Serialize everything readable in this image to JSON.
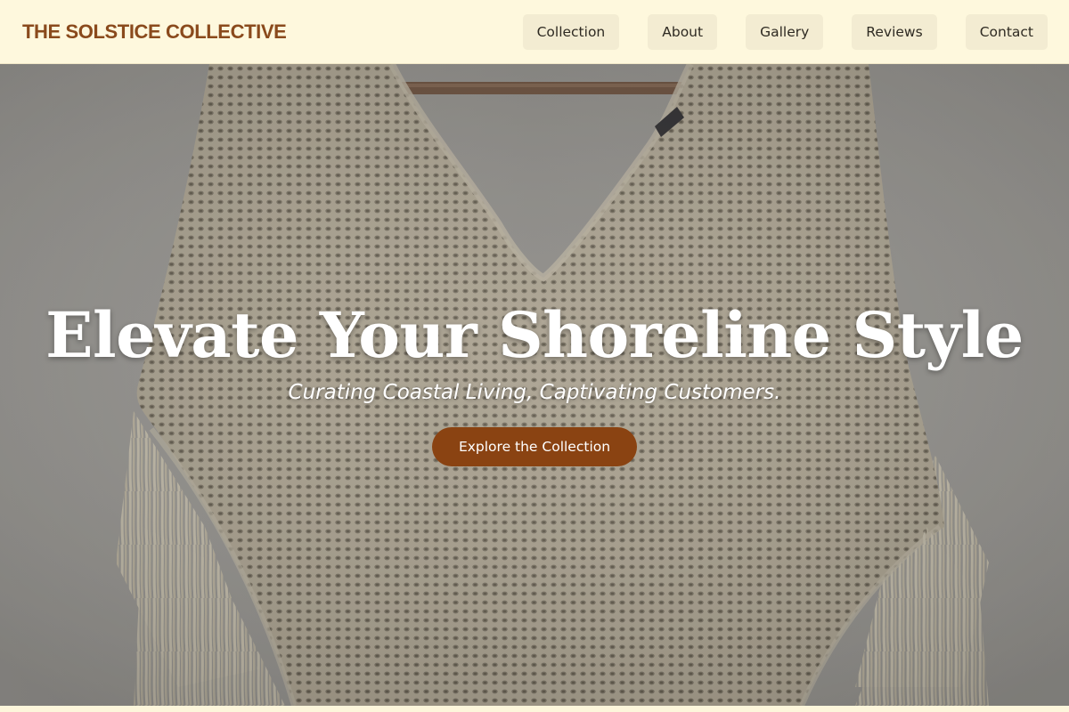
{
  "nav": {
    "brand": "THE SOLSTICE COLLECTIVE",
    "links": [
      {
        "label": "Collection"
      },
      {
        "label": "About"
      },
      {
        "label": "Gallery"
      },
      {
        "label": "Reviews"
      },
      {
        "label": "Contact"
      }
    ]
  },
  "hero": {
    "title": "Elevate Your Shoreline Style",
    "subtitle": "Curating Coastal Living, Captivating Customers.",
    "cta_label": "Explore the Collection",
    "image_subject": "cream crochet knit poncho with fringe hanging on a wooden rod"
  },
  "colors": {
    "nav_bg": "#fef8dd",
    "brand_text": "#8a4a1c",
    "nav_button_bg": "#f3ecd2",
    "cta_bg": "#8a4312",
    "hero_text": "#ffffff"
  }
}
